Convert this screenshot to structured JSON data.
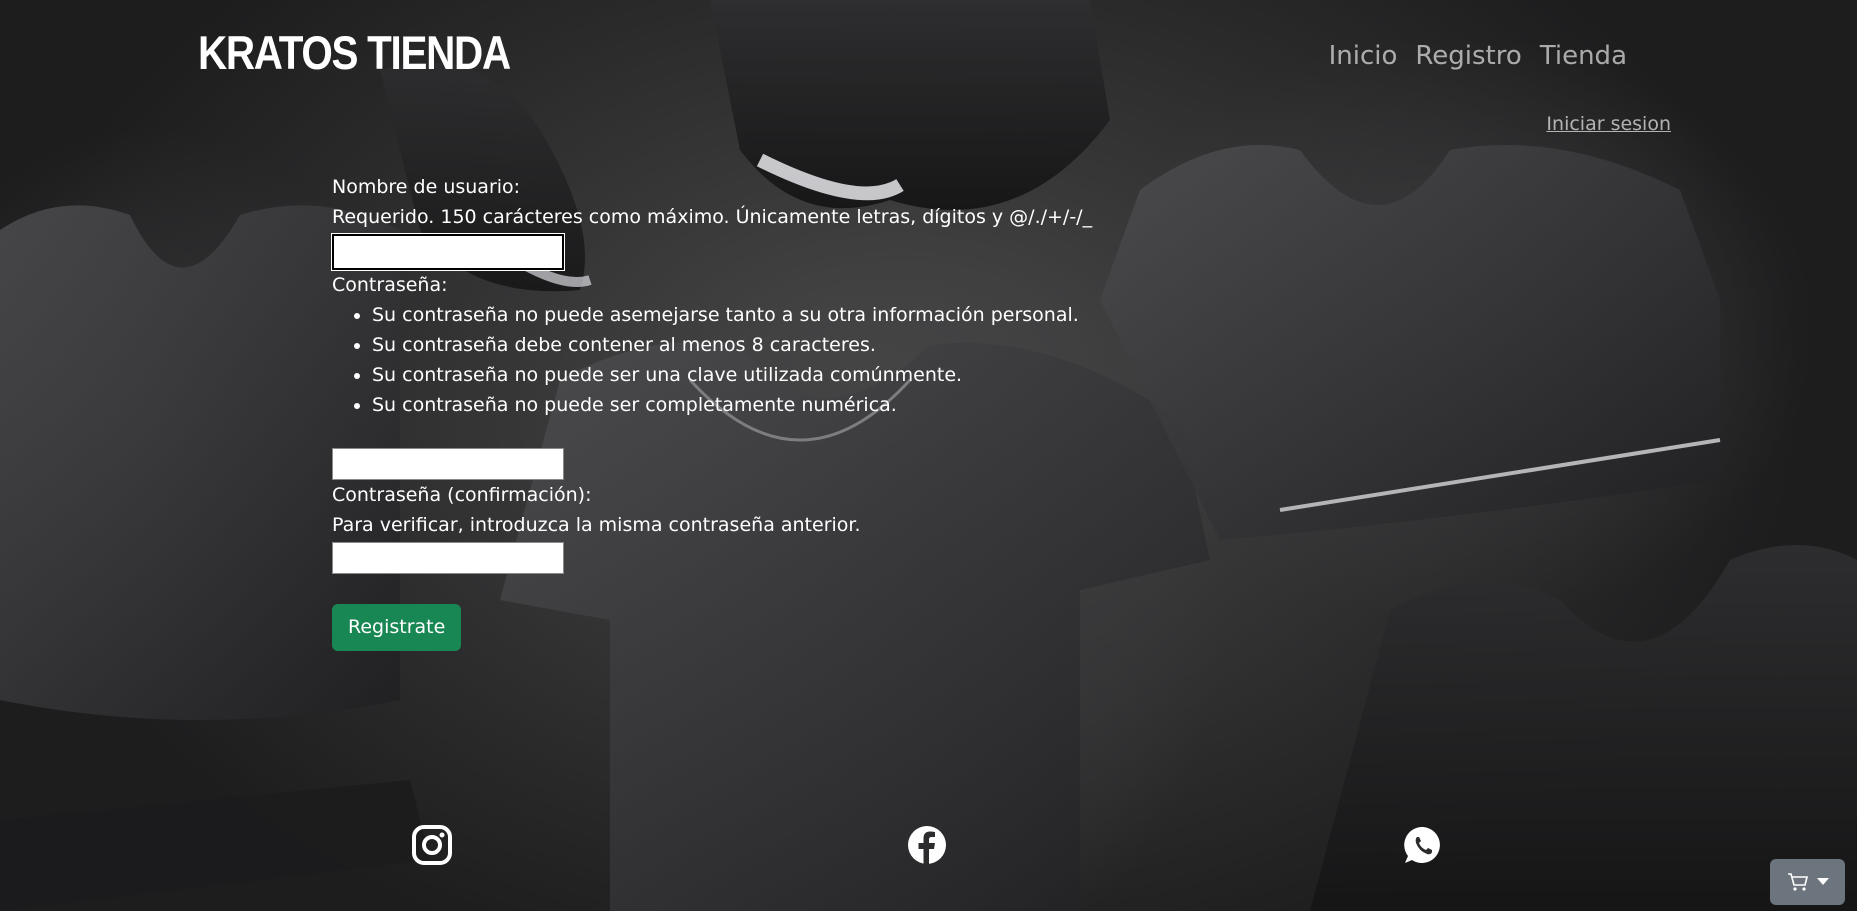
{
  "header": {
    "brand": "KRATOS TIENDA",
    "nav": [
      {
        "label": "Inicio"
      },
      {
        "label": "Registro"
      },
      {
        "label": "Tienda"
      }
    ],
    "login_link": "Iniciar sesion"
  },
  "form": {
    "username_label": "Nombre de usuario:",
    "username_help": "Requerido. 150 carácteres como máximo. Únicamente letras, dígitos y @/./+/-/_",
    "username_value": "",
    "password_label": "Contraseña:",
    "password_rules": [
      "Su contraseña no puede asemejarse tanto a su otra información personal.",
      "Su contraseña debe contener al menos 8 caracteres.",
      "Su contraseña no puede ser una clave utilizada comúnmente.",
      "Su contraseña no puede ser completamente numérica."
    ],
    "password_value": "",
    "confirm_label": "Contraseña (confirmación):",
    "confirm_help": "Para verificar, introduzca la misma contraseña anterior.",
    "confirm_value": "",
    "submit_label": "Registrate"
  },
  "footer": {
    "social": [
      {
        "icon": "instagram-icon"
      },
      {
        "icon": "facebook-icon"
      },
      {
        "icon": "whatsapp-icon"
      }
    ]
  },
  "cart": {
    "icon": "cart-icon",
    "dropdown_icon": "caret-down-icon"
  },
  "colors": {
    "submit": "#198754",
    "cart_button": "#6c757d"
  }
}
